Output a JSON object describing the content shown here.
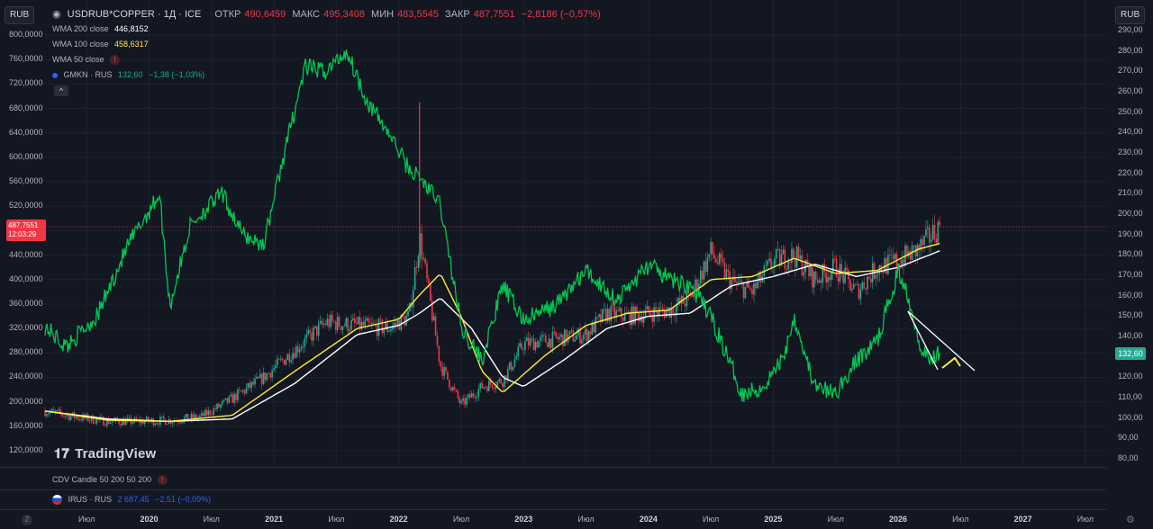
{
  "header": {
    "currency_left": "RUB",
    "currency_right": "RUB",
    "symbol": "USDRUB*COPPER · 1Д · ICE",
    "open_label": "ОТКР",
    "open": "490,6459",
    "high_label": "МАКС",
    "high": "495,3408",
    "low_label": "МИН",
    "low": "483,5545",
    "close_label": "ЗАКР",
    "close": "487,7551",
    "change": "−2,8186 (−0,57%)"
  },
  "indicators": {
    "wma200_label": "WMA 200 close",
    "wma200_value": "446,8152",
    "wma100_label": "WMA 100 close",
    "wma100_value": "458,6317",
    "wma50_label": "WMA 50 close",
    "gmkn_label": "GMKN · RUS",
    "gmkn_value": "132,60",
    "gmkn_change": "−1,38 (−1,03%)"
  },
  "lower_panes": {
    "cdv_label": "CDV Candle 50 200 50 200",
    "irus_label": "IRUS · RUS",
    "irus_value": "2 687,45",
    "irus_change": "−2,51 (−0,09%)"
  },
  "price_tag": {
    "price": "487,7551",
    "countdown": "12:03:29"
  },
  "gmkn_tag": "132,60",
  "branding": "TradingView",
  "icons": {
    "warning": "!",
    "collapse": "^",
    "zoom": "Z",
    "settings": "⚙",
    "gmkn_dot": "#2962ff",
    "flag": "russia-flag"
  },
  "colors": {
    "background": "#131722",
    "up": "#22ab94",
    "down": "#f23645",
    "gmkn": "#00c853",
    "wma100": "#ffeb3b",
    "wma200": "#ffffff",
    "grid": "#1e222d"
  },
  "chart_data": {
    "type": "line",
    "y_left_ticks": [
      "800,0000",
      "760,0000",
      "720,0000",
      "680,0000",
      "640,0000",
      "600,0000",
      "560,0000",
      "520,0000",
      "480,0000",
      "440,0000",
      "400,0000",
      "360,0000",
      "320,0000",
      "280,0000",
      "240,0000",
      "200,0000",
      "160,0000",
      "120,0000"
    ],
    "y_right_ticks": [
      "290,00",
      "280,00",
      "270,00",
      "260,00",
      "250,00",
      "240,00",
      "230,00",
      "220,00",
      "210,00",
      "200,00",
      "190,00",
      "180,00",
      "170,00",
      "160,00",
      "150,00",
      "140,00",
      "130,00",
      "120,00",
      "110,00",
      "100,00",
      "90,00",
      "80,00"
    ],
    "x_ticks": [
      {
        "label": "Июл",
        "year": false
      },
      {
        "label": "2020",
        "year": true
      },
      {
        "label": "Июл",
        "year": false
      },
      {
        "label": "2021",
        "year": true
      },
      {
        "label": "Июл",
        "year": false
      },
      {
        "label": "2022",
        "year": true
      },
      {
        "label": "Июл",
        "year": false
      },
      {
        "label": "2023",
        "year": true
      },
      {
        "label": "Июл",
        "year": false
      },
      {
        "label": "2024",
        "year": true
      },
      {
        "label": "Июл",
        "year": false
      },
      {
        "label": "2025",
        "year": true
      },
      {
        "label": "Июл",
        "year": false
      },
      {
        "label": "2026",
        "year": true
      },
      {
        "label": "Июл",
        "year": false
      },
      {
        "label": "2027",
        "year": true
      },
      {
        "label": "Июл",
        "year": false
      }
    ],
    "ylim_left": [
      120,
      800
    ],
    "ylim_right": [
      80,
      290
    ],
    "grid": true,
    "series": [
      {
        "name": "USDRUB*COPPER",
        "axis": "left",
        "x": [
          "2019-03",
          "2019-06",
          "2019-09",
          "2019-12",
          "2020-03",
          "2020-06",
          "2020-09",
          "2020-12",
          "2021-03",
          "2021-06",
          "2021-09",
          "2021-12",
          "2022-02",
          "2022-03",
          "2022-05",
          "2022-07",
          "2022-09",
          "2022-11",
          "2023-01",
          "2023-03",
          "2023-05",
          "2023-07",
          "2023-09",
          "2023-11",
          "2024-01",
          "2024-03",
          "2024-05",
          "2024-07",
          "2024-09",
          "2024-11",
          "2025-01",
          "2025-03",
          "2025-05",
          "2025-07",
          "2025-09",
          "2025-11",
          "2026-01",
          "2026-03",
          "2026-05"
        ],
        "values": [
          185,
          175,
          168,
          168,
          170,
          175,
          205,
          240,
          285,
          330,
          325,
          320,
          340,
          470,
          260,
          195,
          225,
          235,
          295,
          300,
          305,
          310,
          345,
          340,
          345,
          350,
          370,
          445,
          395,
          380,
          430,
          440,
          400,
          420,
          380,
          420,
          430,
          450,
          488
        ]
      },
      {
        "name": "WMA 100 close",
        "axis": "left",
        "x": [
          "2019-03",
          "2019-09",
          "2020-03",
          "2020-09",
          "2021-03",
          "2021-09",
          "2022-01",
          "2022-03",
          "2022-05",
          "2022-07",
          "2022-09",
          "2022-11",
          "2023-03",
          "2023-07",
          "2023-11",
          "2024-03",
          "2024-07",
          "2024-11",
          "2025-03",
          "2025-07",
          "2025-11",
          "2026-03",
          "2026-05"
        ],
        "values": [
          185,
          170,
          168,
          178,
          250,
          320,
          335,
          375,
          410,
          340,
          250,
          215,
          275,
          325,
          345,
          350,
          400,
          405,
          435,
          410,
          415,
          450,
          459
        ]
      },
      {
        "name": "WMA 200 close",
        "axis": "left",
        "x": [
          "2019-03",
          "2019-09",
          "2020-03",
          "2020-09",
          "2021-03",
          "2021-09",
          "2022-01",
          "2022-03",
          "2022-05",
          "2022-08",
          "2022-11",
          "2023-01",
          "2023-05",
          "2023-09",
          "2024-01",
          "2024-05",
          "2024-09",
          "2025-01",
          "2025-05",
          "2025-09",
          "2026-01",
          "2026-05"
        ],
        "values": [
          185,
          172,
          168,
          172,
          230,
          310,
          325,
          345,
          370,
          320,
          240,
          225,
          270,
          320,
          340,
          345,
          390,
          405,
          425,
          405,
          420,
          447
        ]
      },
      {
        "name": "GMKN · RUS",
        "axis": "right",
        "x": [
          "2019-03",
          "2019-05",
          "2019-08",
          "2019-11",
          "2020-02",
          "2020-03",
          "2020-05",
          "2020-08",
          "2020-10",
          "2020-12",
          "2021-02",
          "2021-04",
          "2021-06",
          "2021-08",
          "2021-10",
          "2021-12",
          "2022-02",
          "2022-03",
          "2022-05",
          "2022-07",
          "2022-09",
          "2022-11",
          "2023-01",
          "2023-04",
          "2023-07",
          "2023-10",
          "2024-01",
          "2024-03",
          "2024-05",
          "2024-07",
          "2024-09",
          "2024-10",
          "2024-12",
          "2025-02",
          "2025-03",
          "2025-05",
          "2025-07",
          "2025-09",
          "2025-11",
          "2026-01",
          "2026-02",
          "2026-03",
          "2026-04",
          "2026-05"
        ],
        "values": [
          145,
          135,
          150,
          185,
          210,
          155,
          195,
          210,
          190,
          185,
          230,
          272,
          270,
          280,
          255,
          240,
          222,
          218,
          205,
          145,
          128,
          165,
          148,
          155,
          172,
          158,
          175,
          168,
          165,
          150,
          125,
          112,
          115,
          130,
          150,
          115,
          112,
          128,
          138,
          172,
          160,
          138,
          128,
          133
        ]
      }
    ]
  }
}
